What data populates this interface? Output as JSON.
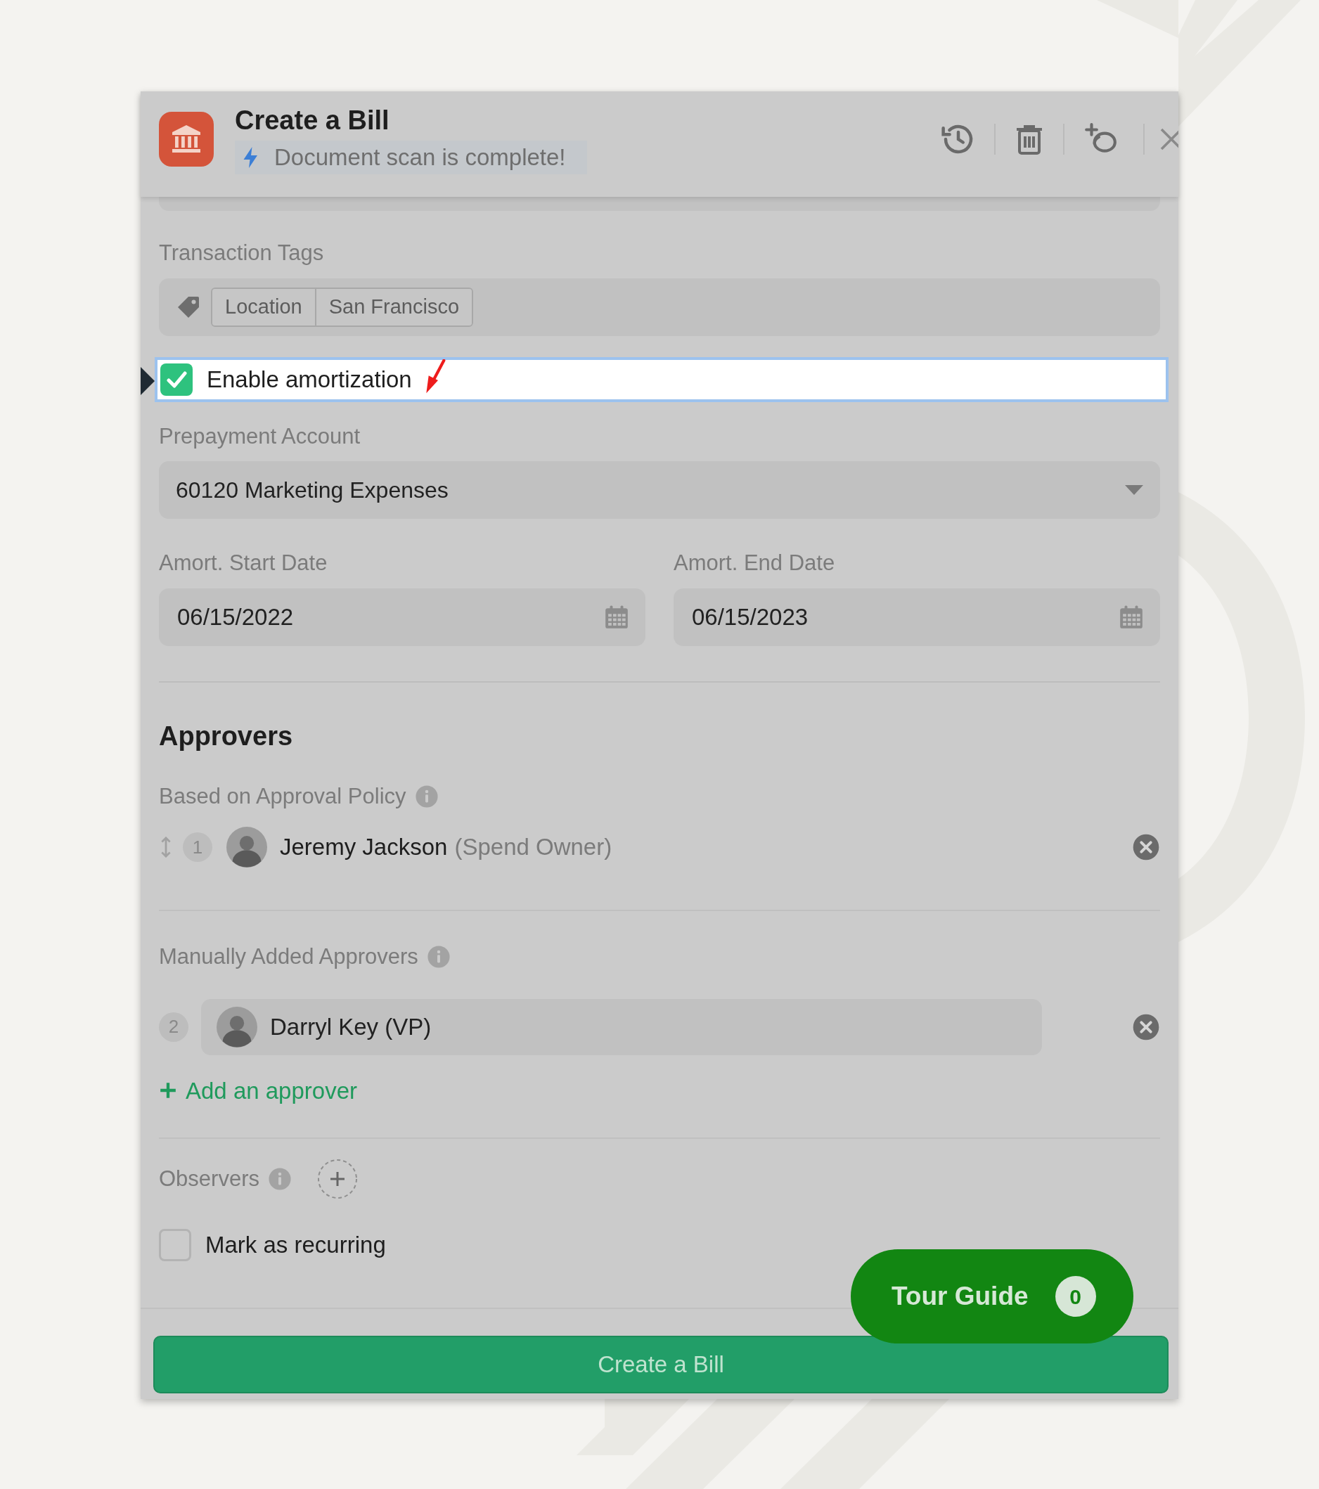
{
  "header": {
    "title": "Create a Bill",
    "subtitle": "Document scan is complete!"
  },
  "tags_field": {
    "label": "Transaction Tags",
    "tags": [
      "Location",
      "San Francisco"
    ]
  },
  "amortization": {
    "label": "Enable amortization",
    "checked": true
  },
  "prepayment_account": {
    "label": "Prepayment Account",
    "value": "60120 Marketing Expenses"
  },
  "dates": [
    {
      "label": "Amort. Start Date",
      "value": "06/15/2022"
    },
    {
      "label": "Amort. End Date",
      "value": "06/15/2023"
    }
  ],
  "approvers": {
    "heading": "Approvers",
    "policy_label": "Based on Approval Policy",
    "policy_approvers": [
      {
        "number": "1",
        "name": "Jeremy Jackson",
        "role": "(Spend Owner)"
      }
    ],
    "manual_label": "Manually Added Approvers",
    "manual_approvers": [
      {
        "number": "2",
        "name": "Darryl Key (VP)"
      }
    ],
    "add_link": "Add an approver"
  },
  "observers": {
    "label": "Observers"
  },
  "recurring": {
    "label": "Mark as recurring",
    "checked": false
  },
  "tour_guide": {
    "label": "Tour Guide",
    "count": "0"
  },
  "submit": "Create a Bill"
}
